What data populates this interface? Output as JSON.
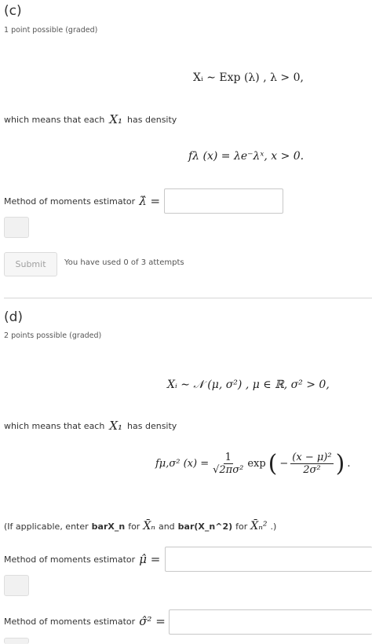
{
  "part_c": {
    "heading": "(c)",
    "points": "1 point possible (graded)",
    "dist_eq": "Xᵢ ∼ Exp (λ) ,   λ > 0,",
    "density_intro": "which means that each",
    "density_var": "X₁",
    "density_suffix": "has density",
    "density_eq": "fλ (x) = λe⁻λˣ,   x > 0.",
    "estimator_label": "Method of moments estimator",
    "estimator_symbol": "λ̂ =",
    "input_value": "",
    "submit_label": "Submit",
    "attempts": "You have used 0 of 3 attempts"
  },
  "part_d": {
    "heading": "(d)",
    "points": "2 points possible (graded)",
    "dist_eq": "Xᵢ ∼ 𝒩 (μ, σ²) ,   μ ∈ ℝ, σ² > 0,",
    "density_intro": "which means that each",
    "density_var": "X₁",
    "density_suffix": "has density",
    "density_lhs": "fμ,σ² (x) =",
    "density_frac_num": "1",
    "density_frac_den": "√2πσ²",
    "density_exp": "exp",
    "density_inner_num": "(x − μ)²",
    "density_inner_den": "2σ²",
    "density_end": ".",
    "hint_prefix": "(If applicable, enter",
    "hint_bold1": "barX_n",
    "hint_for1": "for",
    "hint_sym1": "X̄ₙ",
    "hint_and": "and",
    "hint_bold2": "bar(X_n^2)",
    "hint_for2": "for",
    "hint_sym2": "X̄ₙ²",
    "hint_suffix": ".)",
    "estimator1_label": "Method of moments estimator",
    "estimator1_symbol": "μ̂ =",
    "estimator2_label": "Method of moments estimator",
    "estimator2_symbol": "σ̂² ="
  }
}
